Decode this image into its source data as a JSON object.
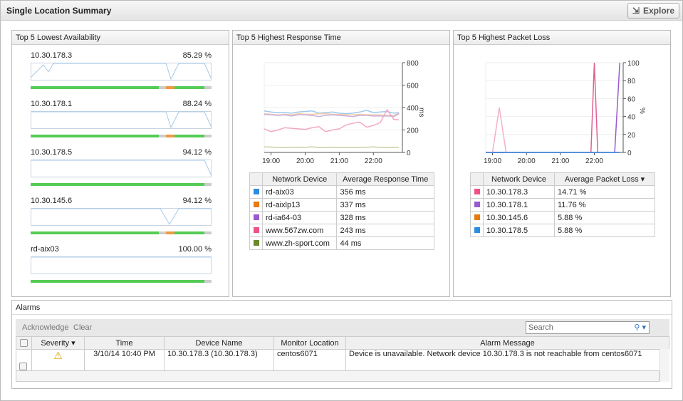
{
  "header": {
    "title": "Single Location Summary",
    "explore_label": "Explore"
  },
  "availability": {
    "title": "Top 5 Lowest Availability",
    "items": [
      {
        "device": "10.30.178.3",
        "value": "85.29 %"
      },
      {
        "device": "10.30.178.1",
        "value": "88.24 %"
      },
      {
        "device": "10.30.178.5",
        "value": "94.12 %"
      },
      {
        "device": "10.30.145.6",
        "value": "94.12 %"
      },
      {
        "device": "rd-aix03",
        "value": "100.00 %"
      }
    ]
  },
  "response": {
    "title": "Top 5 Highest Response Time",
    "col_device": "Network Device",
    "col_value": "Average Response Time",
    "rows": [
      {
        "device": "rd-aix03",
        "value": "356 ms",
        "color": "#2b8ce0"
      },
      {
        "device": "rd-aixlp13",
        "value": "337 ms",
        "color": "#e87a10"
      },
      {
        "device": "rd-ia64-03",
        "value": "328 ms",
        "color": "#9a5ad0"
      },
      {
        "device": "www.567zw.com",
        "value": "243 ms",
        "color": "#f0508a"
      },
      {
        "device": "www.zh-sport.com",
        "value": "44 ms",
        "color": "#6a8a30"
      }
    ]
  },
  "packet": {
    "title": "Top 5 Highest Packet Loss",
    "col_device": "Network Device",
    "col_value": "Average Packet Loss",
    "rows": [
      {
        "device": "10.30.178.3",
        "value": "14.71 %",
        "color": "#f0508a"
      },
      {
        "device": "10.30.178.1",
        "value": "11.76 %",
        "color": "#9a5ad0"
      },
      {
        "device": "10.30.145.6",
        "value": "5.88 %",
        "color": "#e87a10"
      },
      {
        "device": "10.30.178.5",
        "value": "5.88 %",
        "color": "#2b8ce0"
      }
    ]
  },
  "chart_data": [
    {
      "type": "line",
      "title": "Top 5 Highest Response Time",
      "ylabel": "ms",
      "ylim": [
        0,
        800
      ],
      "yticks": [
        "0",
        "200",
        "400",
        "600",
        "800"
      ],
      "xticks": [
        "19:00",
        "20:00",
        "21:00",
        "22:00"
      ],
      "x_hours": [
        18.8,
        19.0,
        19.2,
        19.4,
        19.6,
        19.8,
        20.0,
        20.2,
        20.4,
        20.6,
        20.8,
        21.0,
        21.2,
        21.4,
        21.6,
        21.8,
        22.0,
        22.2,
        22.4,
        22.6,
        22.75
      ],
      "series": [
        {
          "name": "rd-aix03",
          "color": "#9cc8f0",
          "values": [
            370,
            360,
            355,
            355,
            350,
            360,
            365,
            370,
            350,
            355,
            360,
            350,
            345,
            350,
            360,
            375,
            355,
            360,
            365,
            350,
            355
          ]
        },
        {
          "name": "rd-aixlp13",
          "color": "#f5c8a0",
          "values": [
            345,
            340,
            335,
            340,
            335,
            345,
            340,
            340,
            345,
            345,
            340,
            340,
            335,
            335,
            340,
            335,
            335,
            335,
            330,
            330,
            350
          ]
        },
        {
          "name": "rd-ia64-03",
          "color": "#c8b0e0",
          "values": [
            340,
            335,
            330,
            335,
            325,
            335,
            335,
            330,
            320,
            330,
            335,
            330,
            325,
            320,
            330,
            330,
            325,
            325,
            325,
            320,
            345
          ]
        },
        {
          "name": "www.567zw.com",
          "color": "#f5a8c0",
          "values": [
            210,
            185,
            200,
            220,
            215,
            210,
            205,
            220,
            230,
            185,
            200,
            210,
            245,
            260,
            270,
            225,
            240,
            265,
            380,
            295,
            290,
            280,
            290
          ]
        },
        {
          "name": "www.zh-sport.com",
          "color": "#c8d0a8",
          "values": [
            50,
            48,
            45,
            44,
            45,
            46,
            45,
            50,
            44,
            44,
            45,
            44,
            44,
            45,
            44,
            45,
            50,
            44,
            44,
            44,
            44
          ]
        }
      ]
    },
    {
      "type": "line",
      "title": "Top 5 Highest Packet Loss",
      "ylabel": "%",
      "ylim": [
        0,
        100
      ],
      "yticks": [
        "0",
        "20",
        "40",
        "60",
        "80",
        "100"
      ],
      "xticks": [
        "19:00",
        "20:00",
        "21:00",
        "22:00"
      ],
      "x_hours": [
        18.8,
        19.0,
        19.2,
        19.4,
        19.6,
        19.8,
        20.0,
        20.2,
        20.4,
        20.6,
        20.8,
        21.0,
        21.2,
        21.4,
        21.6,
        21.8,
        21.9,
        22.0,
        22.1,
        22.2,
        22.4,
        22.6,
        22.75
      ],
      "series": [
        {
          "name": "10.30.178.3",
          "color": "#e06090",
          "values": [
            0,
            0,
            0,
            0,
            0,
            0,
            0,
            0,
            0,
            0,
            0,
            0,
            0,
            0,
            0,
            0,
            0,
            100,
            0,
            0,
            0,
            0,
            0
          ]
        },
        {
          "name": "10.30.178.1",
          "color": "#9a5ad0",
          "values": [
            0,
            0,
            0,
            0,
            0,
            0,
            0,
            0,
            0,
            0,
            0,
            0,
            0,
            0,
            0,
            0,
            0,
            0,
            0,
            0,
            0,
            0,
            100
          ]
        },
        {
          "name": "10.30.145.6",
          "color": "#f5b0c8",
          "values": [
            0,
            0,
            50,
            0,
            0,
            0,
            0,
            0,
            0,
            0,
            0,
            0,
            0,
            0,
            0,
            0,
            0,
            0,
            0,
            0,
            0,
            0,
            0
          ]
        },
        {
          "name": "10.30.178.5",
          "color": "#2b8ce0",
          "values": [
            0,
            0,
            0,
            0,
            0,
            0,
            0,
            0,
            0,
            0,
            0,
            0,
            0,
            0,
            0,
            0,
            0,
            0,
            0,
            0,
            0,
            0,
            0
          ]
        }
      ]
    }
  ],
  "alarms": {
    "title": "Alarms",
    "acknowledge": "Acknowledge",
    "clear": "Clear",
    "search_placeholder": "Search",
    "columns": [
      "Severity",
      "Time",
      "Device Name",
      "Monitor Location",
      "Alarm Message"
    ],
    "rows": [
      {
        "time": "3/10/14 10:40 PM",
        "device": "10.30.178.3 (10.30.178.3)",
        "location": "centos6071",
        "message": "Device is unavailable. Network device 10.30.178.3 is not reachable from centos6071"
      }
    ]
  }
}
